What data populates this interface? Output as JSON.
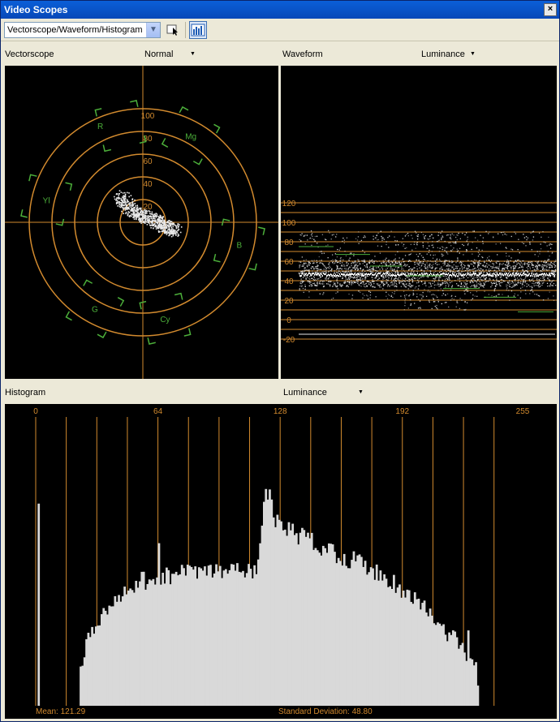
{
  "window": {
    "title": "Video Scopes",
    "close": "×"
  },
  "toolbar": {
    "scope_select": {
      "value": "Vectorscope/Waveform/Histogram"
    }
  },
  "vectorscope": {
    "title": "Vectorscope",
    "mode": "Normal",
    "ring_labels": [
      "20",
      "40",
      "60",
      "80",
      "100"
    ],
    "targets": [
      "R",
      "Mg",
      "B",
      "Cy",
      "G",
      "Yl"
    ]
  },
  "waveform": {
    "title": "Waveform",
    "mode": "Luminance",
    "axis_labels": [
      "120",
      "100",
      "80",
      "60",
      "40",
      "20",
      "0",
      "-20"
    ]
  },
  "histogram": {
    "title": "Histogram",
    "mode": "Luminance",
    "axis_labels": [
      "0",
      "64",
      "128",
      "192",
      "255"
    ],
    "mean_text": "Mean: 121.29",
    "stddev_text": "Standard Deviation: 48.80"
  },
  "colors": {
    "grid_orange": "#d28a2e",
    "target_green": "#4caf3a",
    "trace_white": "#e8e8e8"
  },
  "icons": [
    "close-icon",
    "dropdown-arrow-icon",
    "pointer-tool-icon",
    "histogram-view-icon"
  ]
}
